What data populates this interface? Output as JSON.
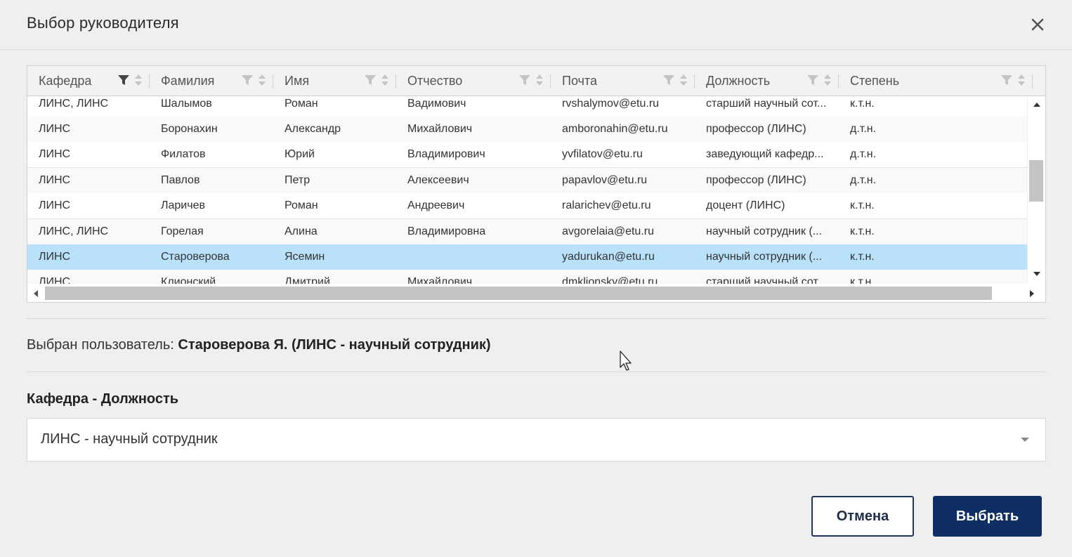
{
  "dialog": {
    "title": "Выбор руководителя"
  },
  "grid": {
    "columns": [
      {
        "label": "Кафедра",
        "filter_active": true
      },
      {
        "label": "Фамилия",
        "filter_active": false
      },
      {
        "label": "Имя",
        "filter_active": false
      },
      {
        "label": "Отчество",
        "filter_active": false
      },
      {
        "label": "Почта",
        "filter_active": false
      },
      {
        "label": "Должность",
        "filter_active": false
      },
      {
        "label": "Степень",
        "filter_active": false
      }
    ],
    "rows": [
      [
        "ЛИНС, ЛИНС",
        "Шалымов",
        "Роман",
        "Вадимович",
        "rvshalymov@etu.ru",
        "старший научный сот...",
        "к.т.н."
      ],
      [
        "ЛИНС",
        "Боронахин",
        "Александр",
        "Михайлович",
        "amboronahin@etu.ru",
        "профессор (ЛИНС)",
        "д.т.н."
      ],
      [
        "ЛИНС",
        "Филатов",
        "Юрий",
        "Владимирович",
        "yvfilatov@etu.ru",
        "заведующий кафедр...",
        "д.т.н."
      ],
      [
        "ЛИНС",
        "Павлов",
        "Петр",
        "Алексеевич",
        "papavlov@etu.ru",
        "профессор (ЛИНС)",
        "д.т.н."
      ],
      [
        "ЛИНС",
        "Ларичев",
        "Роман",
        "Андреевич",
        "ralarichev@etu.ru",
        "доцент (ЛИНС)",
        "к.т.н."
      ],
      [
        "ЛИНС, ЛИНС",
        "Горелая",
        "Алина",
        "Владимировна",
        "avgorelaia@etu.ru",
        "научный сотрудник (...",
        "к.т.н."
      ],
      [
        "ЛИНС",
        "Староверова",
        "Ясемин",
        "",
        "yadurukan@etu.ru",
        "научный сотрудник (...",
        "к.т.н."
      ],
      [
        "ЛИНС",
        "Клионский",
        "Дмитрий",
        "Михайлович",
        "dmklionsky@etu.ru",
        "старший научный сот...",
        "к.т.н."
      ]
    ],
    "selected_row_index": 6
  },
  "selection": {
    "prefix": "Выбран пользователь: ",
    "value": "Староверова Я. (ЛИНС - научный сотрудник)"
  },
  "position_field": {
    "label": "Кафедра - Должность",
    "value": "ЛИНС - научный сотрудник"
  },
  "buttons": {
    "cancel": "Отмена",
    "ok": "Выбрать"
  },
  "colors": {
    "selected_row": "#b9e1fa",
    "primary": "#0f2e63"
  }
}
